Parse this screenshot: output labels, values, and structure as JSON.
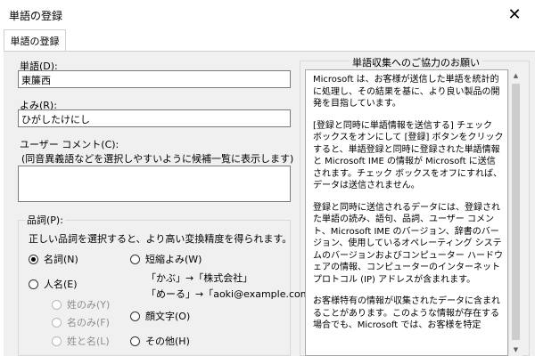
{
  "window": {
    "title": "単語の登録"
  },
  "tabs": [
    {
      "label": "単語の登録"
    }
  ],
  "form": {
    "word_label": "単語(D):",
    "word_value": "東簾西",
    "reading_label": "よみ(R):",
    "reading_value": "ひがしたけにし",
    "comment_label": "ユーザー コメント(C):",
    "comment_hint": "(同音異義語などを選択しやすいように候補一覧に表示します)",
    "comment_value": ""
  },
  "pos": {
    "title": "品詞(P):",
    "hint": "正しい品詞を選択すると、より高い変換精度を得られます。",
    "options": [
      {
        "label": "名詞(N)",
        "checked": true,
        "disabled": false
      },
      {
        "label": "人名(E)",
        "checked": false,
        "disabled": false
      },
      {
        "label": "姓のみ(Y)",
        "checked": false,
        "disabled": true
      },
      {
        "label": "名のみ(F)",
        "checked": false,
        "disabled": true
      },
      {
        "label": "姓と名(L)",
        "checked": false,
        "disabled": true
      },
      {
        "label": "短縮よみ(W)",
        "checked": false,
        "disabled": false
      },
      {
        "label": "顔文字(O)",
        "checked": false,
        "disabled": false
      },
      {
        "label": "その他(H)",
        "checked": false,
        "disabled": false
      }
    ],
    "short_example_1": "「かぶ」→「株式会社」",
    "short_example_2": "「めーる」→「aoki@example.com」"
  },
  "info": {
    "title": "単語収集へのご協力のお願い",
    "paragraphs": [
      "Microsoft は、お客様が送信した単語を統計的に処理し、その結果を基に、より良い製品の開発を目指しています。",
      "[登録と同時に単語情報を送信する] チェック ボックスをオンにして [登録] ボタンをクリックすると、単語登録と同時に登録された単語情報と Microsoft IME の情報が Microsoft に送信されます。チェック ボックスをオフにすれば、データは送信されません。",
      "登録と同時に送信されるデータには、登録された単語の読み、語句、品詞、ユーザー コメント、Microsoft IME のバージョン、辞書のバージョン、使用しているオペレーティング システムのバージョンおよびコンピューター ハードウェアの情報、コンピューターのインターネット プロトコル (IP) アドレスが含まれます。",
      "お客様特有の情報が収集されたデータに含まれることがあります。このような情報が存在する場合でも、Microsoft では、お客様を特定"
    ]
  },
  "icons": {
    "close": "close-icon",
    "scroll_up": "arrow-up-icon",
    "scroll_down": "arrow-down-icon"
  }
}
